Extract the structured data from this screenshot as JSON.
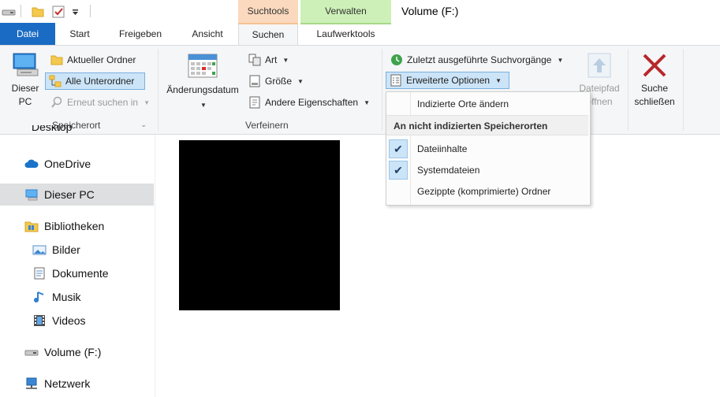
{
  "window": {
    "title": "Volume (F:)",
    "context_tabs": {
      "suchtools": "Suchtools",
      "verwalten": "Verwalten"
    }
  },
  "tabs": {
    "datei": "Datei",
    "start": "Start",
    "freigeben": "Freigeben",
    "ansicht": "Ansicht",
    "suchen": "Suchen",
    "laufwerktools": "Laufwerktools"
  },
  "ribbon": {
    "speicherort": {
      "label": "Speicherort",
      "dieser_pc": "Dieser PC",
      "aktueller_ordner": "Aktueller Ordner",
      "alle_unterordner": "Alle Unterordner",
      "erneut_suchen": "Erneut suchen in"
    },
    "verfeinern": {
      "label": "Verfeinern",
      "aenderungsdatum": "Änderungsdatum",
      "art": "Art",
      "groesse": "Größe",
      "andere_eigenschaften": "Andere Eigenschaften"
    },
    "optionen": {
      "zuletzt": "Zuletzt ausgeführte Suchvorgänge",
      "erweiterte_optionen": "Erweiterte Optionen",
      "dateipfad_line1": "Dateipfad",
      "dateipfad_line2": "öffnen",
      "suche_line1": "Suche",
      "suche_line2": "schließen"
    }
  },
  "dropdown": {
    "indizierte_orte": "Indizierte Orte ändern",
    "header": "An nicht indizierten Speicherorten",
    "dateiinhalte": "Dateiinhalte",
    "systemdateien": "Systemdateien",
    "gezippte": "Gezippte (komprimierte) Ordner"
  },
  "nav": {
    "desktop": "Desktop",
    "onedrive": "OneDrive",
    "dieser_pc": "Dieser PC",
    "bibliotheken": "Bibliotheken",
    "bilder": "Bilder",
    "dokumente": "Dokumente",
    "musik": "Musik",
    "videos": "Videos",
    "volume": "Volume (F:)",
    "netzwerk": "Netzwerk"
  },
  "colors": {
    "accent": "#1a6bc4",
    "suchtools_tab": "#fbd9be",
    "verwalten_tab": "#cdf0b8",
    "close_x": "#b8272d"
  }
}
